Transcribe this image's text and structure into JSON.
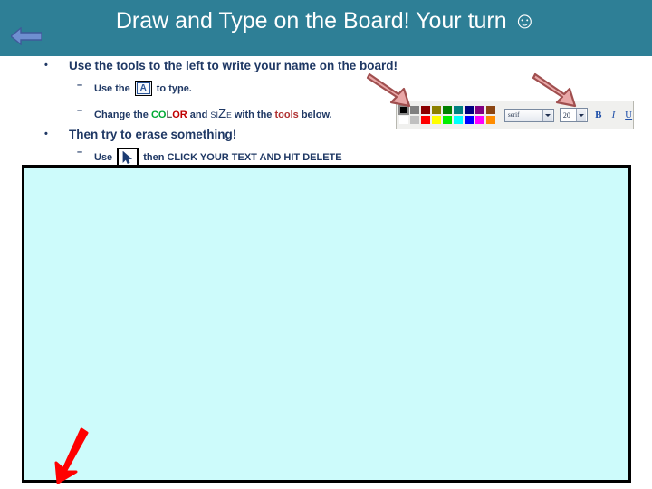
{
  "header": {
    "title": "Draw and Type on the Board! Your turn ☺",
    "bg_color": "#2e7f96",
    "back_arrow_icon": "left-arrow-icon",
    "back_arrow_color": "#5b7fc4"
  },
  "content": {
    "bullet1": {
      "marker": "•",
      "text": "Use the tools to the left to write your name on the board!"
    },
    "sub1": {
      "marker": "–",
      "text_before": "Use the",
      "tool_icon": "text-tool-A-icon",
      "tool_icon_label": "A",
      "text_after": "to type."
    },
    "sub2": {
      "marker": "–",
      "text_before": "Change the",
      "color_word": [
        {
          "ch": "C",
          "color": "#00a933"
        },
        {
          "ch": "O",
          "color": "#00a933"
        },
        {
          "ch": "L",
          "color": "#5a5a5a"
        },
        {
          "ch": "O",
          "color": "#c00000"
        },
        {
          "ch": "R",
          "color": "#c00000"
        }
      ],
      "text_mid": "and",
      "size_word": [
        {
          "ch": "S",
          "size": "small"
        },
        {
          "ch": "I",
          "size": "small"
        },
        {
          "ch": "Z",
          "size": "large"
        },
        {
          "ch": "E",
          "size": "xsmall"
        }
      ],
      "text_mid2": "with the",
      "tools_word": "tools",
      "tools_color": "#b03030",
      "text_after": "below."
    },
    "bullet2": {
      "marker": "•",
      "text": "Then try to erase something!"
    },
    "sub3": {
      "marker": "–",
      "text_before": "Use",
      "cursor_icon": "mouse-pointer-icon",
      "text_after": "then CLICK YOUR TEXT AND HIT DELETE"
    }
  },
  "toolbar": {
    "palette_row_top": [
      "#000000",
      "#808080",
      "#8b0000",
      "#8b8000",
      "#008000",
      "#008080",
      "#000080",
      "#800080",
      "#8b4513"
    ],
    "palette_row_bottom": [
      "#ffffff",
      "#c0c0c0",
      "#ff0000",
      "#ffff00",
      "#00ee00",
      "#00ffff",
      "#0000ff",
      "#ff00ff",
      "#ff8c00"
    ],
    "selected_swatch_index": 0,
    "font_value": "serif",
    "size_value": "20",
    "bold_label": "B",
    "italic_label": "I",
    "underline_label": "U"
  },
  "board": {
    "background": "#cdfbfb",
    "border_color": "#000000",
    "annotation_arrow_color": "#ff0000"
  },
  "annotations": {
    "arrow_to_palette": "red-arrow-icon",
    "arrow_to_font_controls": "red-arrow-icon",
    "arrow_to_board": "red-arrow-icon",
    "arrow_color_light": "#e8a0a0",
    "arrow_color_dark": "#a34a4a"
  }
}
